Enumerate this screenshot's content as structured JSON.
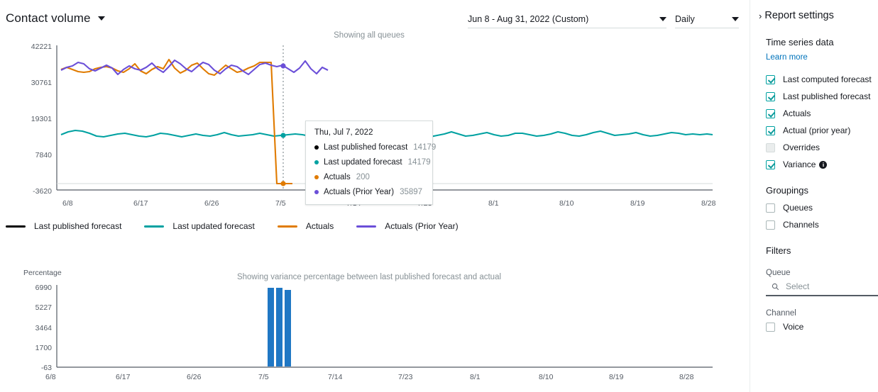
{
  "header": {
    "title": "Contact volume",
    "caret_icon": "chevron-down-icon",
    "date_range": "Jun 8 - Aug 31, 2022 (Custom)",
    "granularity": "Daily"
  },
  "main": {
    "showing_note": "Showing all queues",
    "variance_note": "Showing variance percentage between last published forecast and actual"
  },
  "legend": [
    {
      "label": "Last published forecast",
      "color": "#000000"
    },
    {
      "label": "Last updated forecast",
      "color": "#00a1a1"
    },
    {
      "label": "Actuals",
      "color": "#e07b00"
    },
    {
      "label": "Actuals (Prior Year)",
      "color": "#6b4fd8"
    }
  ],
  "tooltip": {
    "date": "Thu, Jul 7, 2022",
    "rows": [
      {
        "label": "Last published forecast",
        "value": "14179",
        "color": "#000000"
      },
      {
        "label": "Last updated forecast",
        "value": "14179",
        "color": "#00a1a1"
      },
      {
        "label": "Actuals",
        "value": "200",
        "color": "#e07b00"
      },
      {
        "label": "Actuals (Prior Year)",
        "value": "35897",
        "color": "#6b4fd8"
      }
    ]
  },
  "panel": {
    "title": "Report settings",
    "expand_icon": "chevron-right-icon",
    "time_series": {
      "heading": "Time series data",
      "learn_more": "Learn more",
      "items": [
        {
          "label": "Last computed forecast",
          "checked": true,
          "info": false
        },
        {
          "label": "Last published forecast",
          "checked": true,
          "info": false
        },
        {
          "label": "Actuals",
          "checked": true,
          "info": false
        },
        {
          "label": "Actual (prior year)",
          "checked": true,
          "info": false
        },
        {
          "label": "Overrides",
          "checked": false,
          "info": false
        },
        {
          "label": "Variance",
          "checked": true,
          "info": true
        }
      ]
    },
    "groupings": {
      "heading": "Groupings",
      "items": [
        {
          "label": "Queues",
          "checked": false
        },
        {
          "label": "Channels",
          "checked": false
        }
      ]
    },
    "filters": {
      "heading": "Filters",
      "queue_label": "Queue",
      "queue_placeholder": "Select",
      "search_icon": "search-icon",
      "channel_label": "Channel",
      "channel_items": [
        {
          "label": "Voice",
          "checked": false
        }
      ]
    }
  },
  "chart_data": [
    {
      "type": "line",
      "title": "Contact volume",
      "xlabel": "",
      "ylabel": "",
      "ylim": [
        -3620,
        42221
      ],
      "yticks": [
        42221,
        30761,
        19301,
        7840,
        -3620
      ],
      "xticks": [
        "6/8",
        "6/17",
        "6/26",
        "7/5",
        "7/14",
        "7/23",
        "8/1",
        "8/10",
        "8/19",
        "8/28"
      ],
      "grid": false,
      "legend_position": "bottom",
      "cursor_date": "Thu, Jul 7, 2022",
      "series": [
        {
          "name": "Last published forecast",
          "color": "#000000",
          "values": []
        },
        {
          "name": "Last updated forecast",
          "color": "#00a1a1",
          "values": [
            14900,
            15100,
            15400,
            15500,
            15200,
            14600,
            14500,
            14700,
            14900,
            15000,
            14800,
            14600,
            14500,
            14700,
            15100,
            14900,
            14700,
            14500,
            14800,
            15000,
            14700,
            14600,
            14900,
            15200,
            14800,
            14600,
            14700,
            14900,
            15100,
            14800,
            14600,
            14700,
            14900,
            15000,
            14800,
            14600,
            14500,
            14700,
            14900,
            15200,
            14900,
            14600,
            14700,
            14900,
            15100,
            14700,
            14500,
            14700,
            14900,
            15100,
            14800,
            14600,
            14500,
            14700,
            15000,
            15300,
            14900,
            14600,
            14700,
            14900,
            15200,
            14800,
            14600,
            14700,
            15000,
            15100,
            14800,
            14600,
            14700,
            14900,
            15300,
            15000,
            14700,
            14600,
            14800,
            15100,
            15400,
            15000,
            14700,
            14800,
            14900,
            15100,
            14800,
            14600,
            14700,
            14900
          ]
        },
        {
          "name": "Actuals",
          "color": "#e07b00",
          "values": [
            35800,
            36600,
            35900,
            35200,
            35000,
            35300,
            36200,
            36700,
            36900,
            36400,
            35600,
            35000,
            36300,
            37900,
            35600,
            34800,
            36100,
            37000,
            36400,
            39900,
            36800,
            35200,
            36100,
            37600,
            38300,
            36500,
            35000,
            34600,
            36200,
            37600,
            36500,
            35400,
            35800,
            36700,
            37300,
            38600,
            38700,
            200,
            200,
            200
          ]
        },
        {
          "name": "Actuals (Prior Year)",
          "color": "#6b4fd8",
          "values": [
            35700,
            36500,
            37000,
            38200,
            37600,
            36100,
            35300,
            36200,
            37100,
            36300,
            34300,
            35800,
            36900,
            36100,
            35600,
            36500,
            37900,
            36200,
            35100,
            36900,
            39100,
            38000,
            36400,
            35400,
            37100,
            38600,
            37800,
            36000,
            34900,
            36200,
            37400,
            36900,
            35500,
            34500,
            36000,
            37600,
            38200,
            37300,
            36900,
            37500,
            36100,
            35000,
            36200,
            38900,
            36400,
            35100,
            37000,
            36300
          ]
        }
      ]
    },
    {
      "type": "bar",
      "title": "Showing variance percentage between last published forecast and actual",
      "ylabel": "Percentage",
      "ylim": [
        -63,
        6990
      ],
      "yticks": [
        6990,
        5227,
        3464,
        1700,
        -63
      ],
      "xticks": [
        "6/8",
        "6/17",
        "6/26",
        "7/5",
        "7/14",
        "7/23",
        "8/1",
        "8/10",
        "8/19",
        "8/28"
      ],
      "grid": false,
      "bar_color": "#1f77c4",
      "categories": [
        "7/5",
        "7/6",
        "7/7"
      ],
      "values": [
        6990,
        6990,
        6850
      ]
    }
  ]
}
